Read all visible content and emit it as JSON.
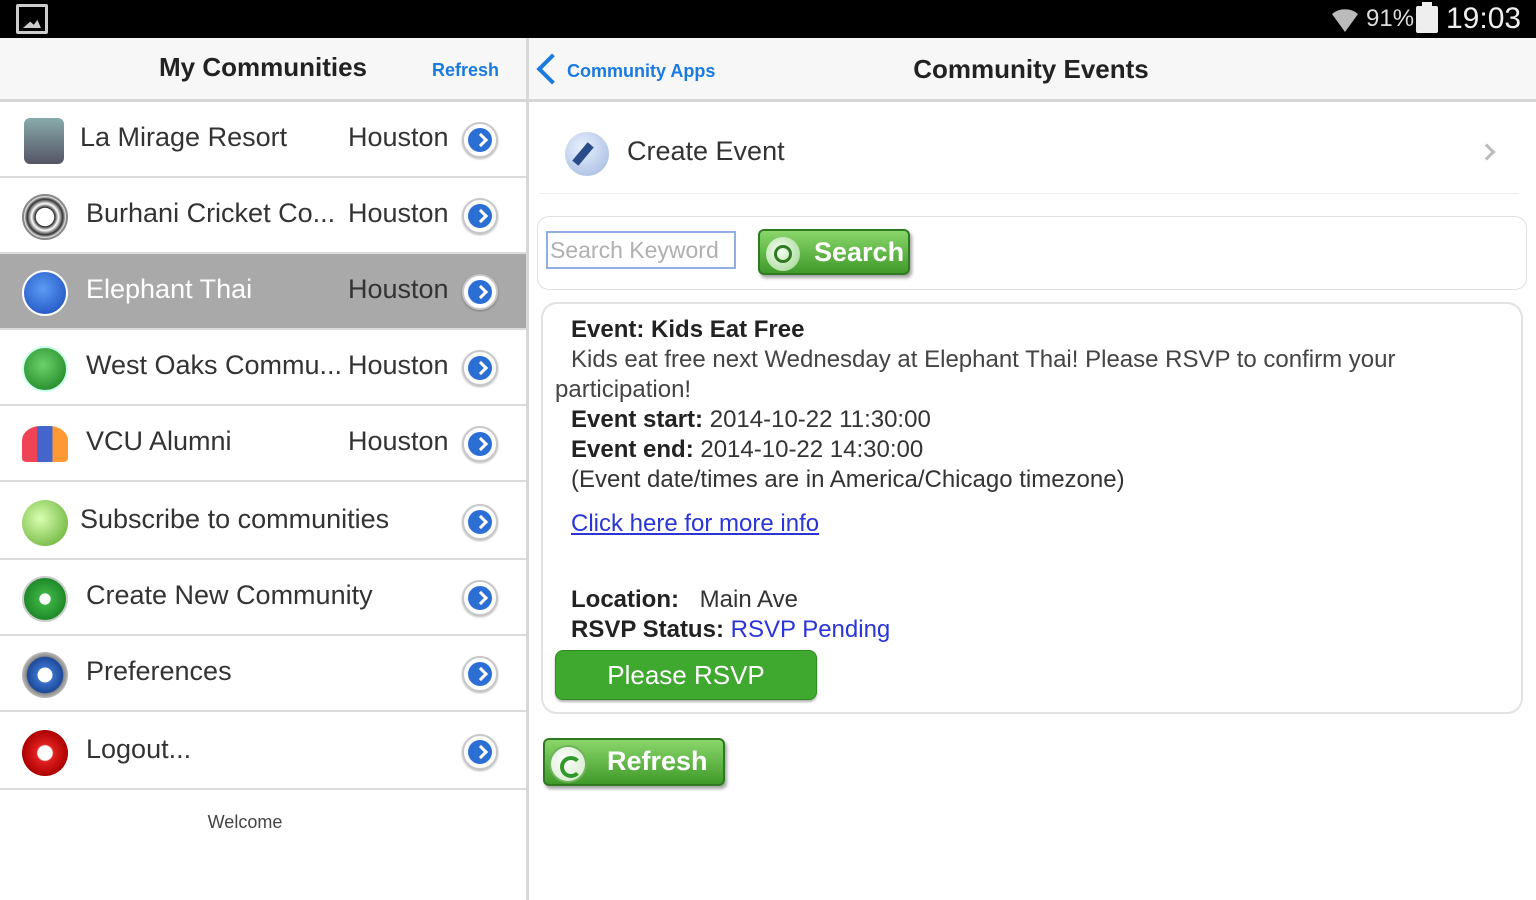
{
  "status_bar": {
    "battery": "91%",
    "time": "19:03"
  },
  "left_panel": {
    "title": "My Communities",
    "refresh_label": "Refresh",
    "communities": [
      {
        "name": "La Mirage Resort",
        "city": "Houston",
        "icon": "building-icon",
        "selected": false
      },
      {
        "name": "Burhani Cricket Co...",
        "city": "Houston",
        "icon": "soccer-ball-icon",
        "selected": false
      },
      {
        "name": "Elephant Thai",
        "city": "Houston",
        "icon": "utensils-icon",
        "selected": true
      },
      {
        "name": "West Oaks Commu...",
        "city": "Houston",
        "icon": "house-icon",
        "selected": false
      },
      {
        "name": "VCU Alumni",
        "city": "Houston",
        "icon": "people-icon",
        "selected": false
      }
    ],
    "actions": [
      {
        "label": "Subscribe to communities",
        "icon": "search-icon"
      },
      {
        "label": "Create New Community",
        "icon": "plus-icon"
      },
      {
        "label": "Preferences",
        "icon": "gear-icon"
      },
      {
        "label": "Logout...",
        "icon": "power-icon"
      }
    ],
    "footer": "Welcome"
  },
  "right_panel": {
    "back_label": "Community Apps",
    "title": "Community Events",
    "create_event_label": "Create Event",
    "search": {
      "placeholder": "Search Keyword",
      "button_label": "Search"
    },
    "event": {
      "title_label": "Event:",
      "title": "Kids Eat Free",
      "description_line1": "Kids eat free next Wednesday at Elephant Thai! Please RSVP to confirm your",
      "description_line2": "participation!",
      "start_label": "Event start:",
      "start": "2014-10-22 11:30:00",
      "end_label": "Event end:",
      "end": "2014-10-22 14:30:00",
      "timezone_note": "(Event date/times are in America/Chicago timezone)",
      "more_info_link": "Click here for more info",
      "location_label": "Location:",
      "location": "Main Ave",
      "rsvp_status_label": "RSVP Status:",
      "rsvp_status": "RSVP Pending",
      "rsvp_button": "Please RSVP"
    },
    "refresh_button": "Refresh"
  },
  "colors": {
    "accent_blue": "#1a7ae0",
    "button_green": "#3fa82e",
    "link_blue": "#2a35d8",
    "selected_row": "#a9a9a9"
  }
}
